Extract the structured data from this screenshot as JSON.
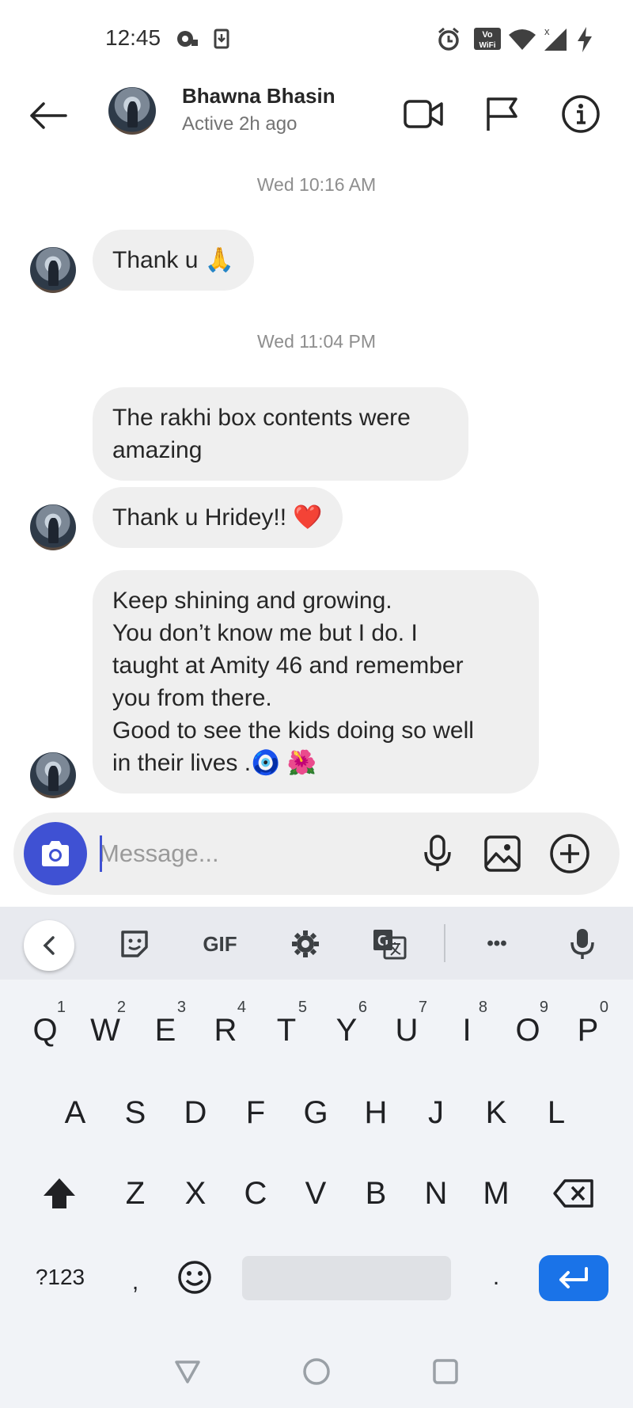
{
  "status_bar": {
    "time": "12:45",
    "icons": [
      "alarm-icon",
      "vowifi-icon",
      "wifi-icon",
      "signal-icon",
      "charging-icon"
    ],
    "vowifi_label": "Vo WiFi"
  },
  "header": {
    "contact_name": "Bhawna Bhasin",
    "contact_status": "Active 2h ago",
    "actions": [
      "video-call",
      "report-flag",
      "info"
    ]
  },
  "chat": {
    "timestamps": [
      "Wed 10:16 AM",
      "Wed 11:04 PM"
    ],
    "messages": [
      {
        "text": "Thank u 🙏"
      },
      {
        "text": "The rakhi box contents were\namazing"
      },
      {
        "text": "Thank u Hridey!! ❤️"
      },
      {
        "text": "Keep shining and growing.\nYou don’t know me but I do. I\ntaught at Amity 46 and remember\nyou from there.\nGood to see the kids doing so well\nin their lives .🧿 🌺"
      }
    ]
  },
  "composer": {
    "placeholder": "Message..."
  },
  "keyboard": {
    "toolbar": {
      "gif_label": "GIF",
      "more_label": "•••"
    },
    "row1": [
      {
        "key": "Q",
        "hint": "1"
      },
      {
        "key": "W",
        "hint": "2"
      },
      {
        "key": "E",
        "hint": "3"
      },
      {
        "key": "R",
        "hint": "4"
      },
      {
        "key": "T",
        "hint": "5"
      },
      {
        "key": "Y",
        "hint": "6"
      },
      {
        "key": "U",
        "hint": "7"
      },
      {
        "key": "I",
        "hint": "8"
      },
      {
        "key": "O",
        "hint": "9"
      },
      {
        "key": "P",
        "hint": "0"
      }
    ],
    "row2": [
      "A",
      "S",
      "D",
      "F",
      "G",
      "H",
      "J",
      "K",
      "L"
    ],
    "row3": [
      "Z",
      "X",
      "C",
      "V",
      "B",
      "N",
      "M"
    ],
    "symbols_label": "?123",
    "comma_label": ",",
    "period_label": "."
  },
  "colors": {
    "accent": "#3f51d3",
    "bubble": "#efefef",
    "enter_key": "#1a73e8",
    "keyboard_bg": "#f1f3f7"
  }
}
